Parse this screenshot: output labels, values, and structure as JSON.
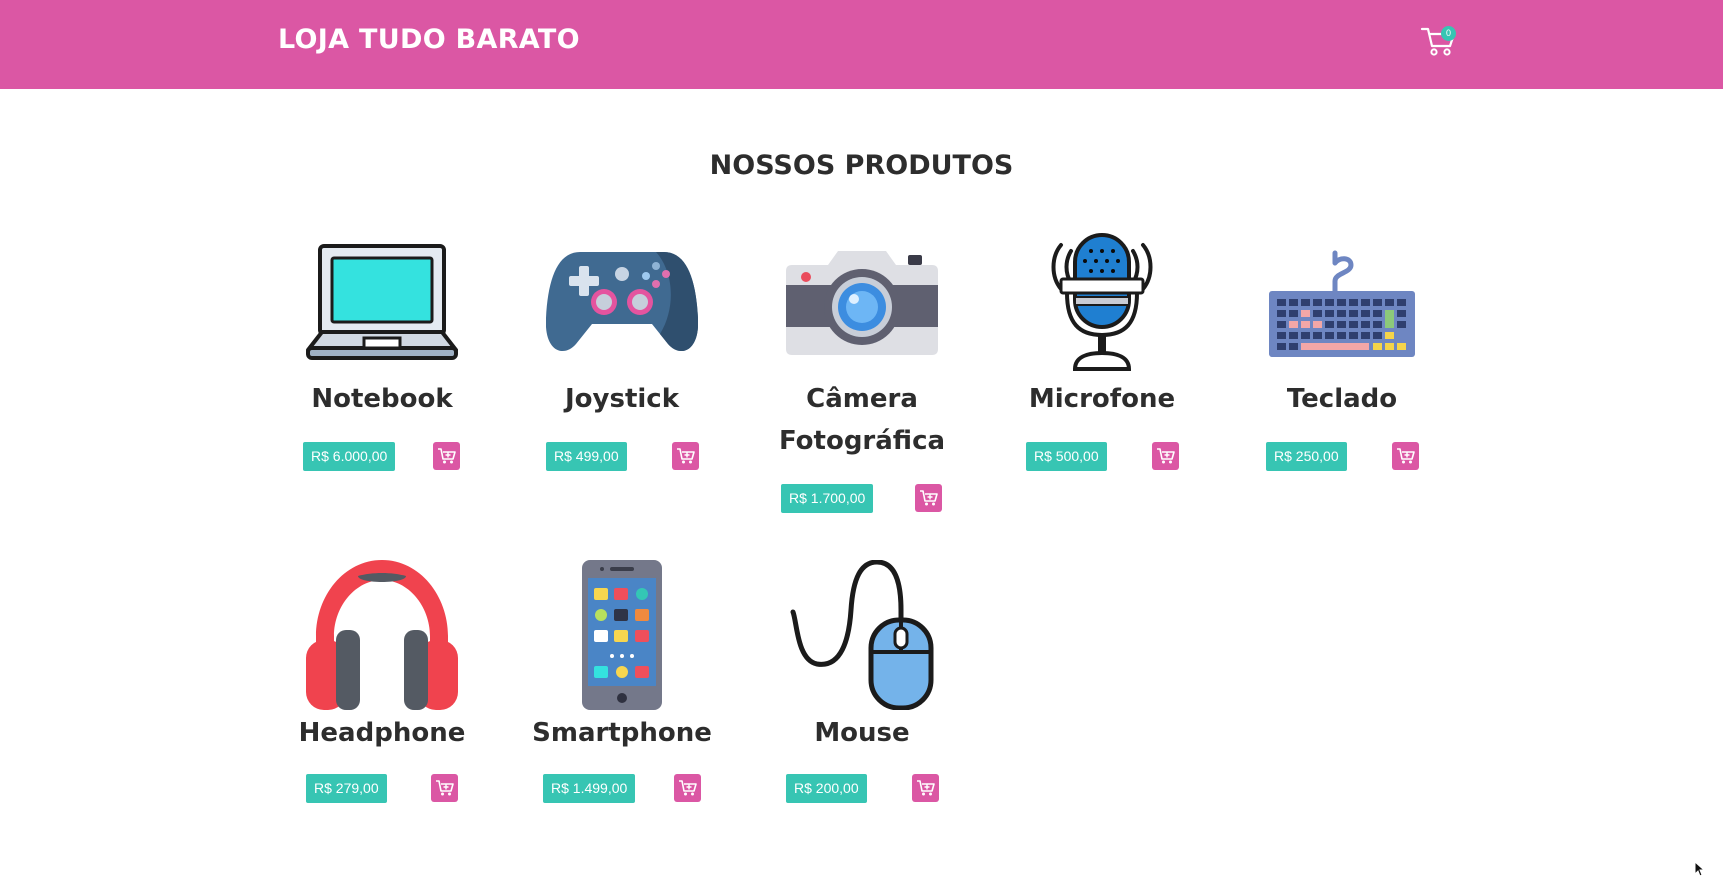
{
  "header": {
    "brand": "LOJA TUDO BARATO",
    "cart_count": "0",
    "cart_icon": "cart-icon"
  },
  "main": {
    "heading": "NOSSOS PRODUTOS"
  },
  "colors": {
    "accent": "#db57a4",
    "price": "#37c5b3",
    "text": "#2d2d2d"
  },
  "products": [
    {
      "name": "Notebook",
      "price": "R$ 6.000,00",
      "icon": "laptop-icon"
    },
    {
      "name": "Joystick",
      "price": "R$ 499,00",
      "icon": "gamepad-icon"
    },
    {
      "name": "Câmera Fotográfica",
      "price": "R$ 1.700,00",
      "icon": "camera-icon"
    },
    {
      "name": "Microfone",
      "price": "R$ 500,00",
      "icon": "microphone-icon"
    },
    {
      "name": "Teclado",
      "price": "R$ 250,00",
      "icon": "keyboard-icon"
    },
    {
      "name": "Headphone",
      "price": "R$ 279,00",
      "icon": "headphone-icon"
    },
    {
      "name": "Smartphone",
      "price": "R$ 1.499,00",
      "icon": "smartphone-icon"
    },
    {
      "name": "Mouse",
      "price": "R$ 200,00",
      "icon": "mouse-icon"
    }
  ]
}
